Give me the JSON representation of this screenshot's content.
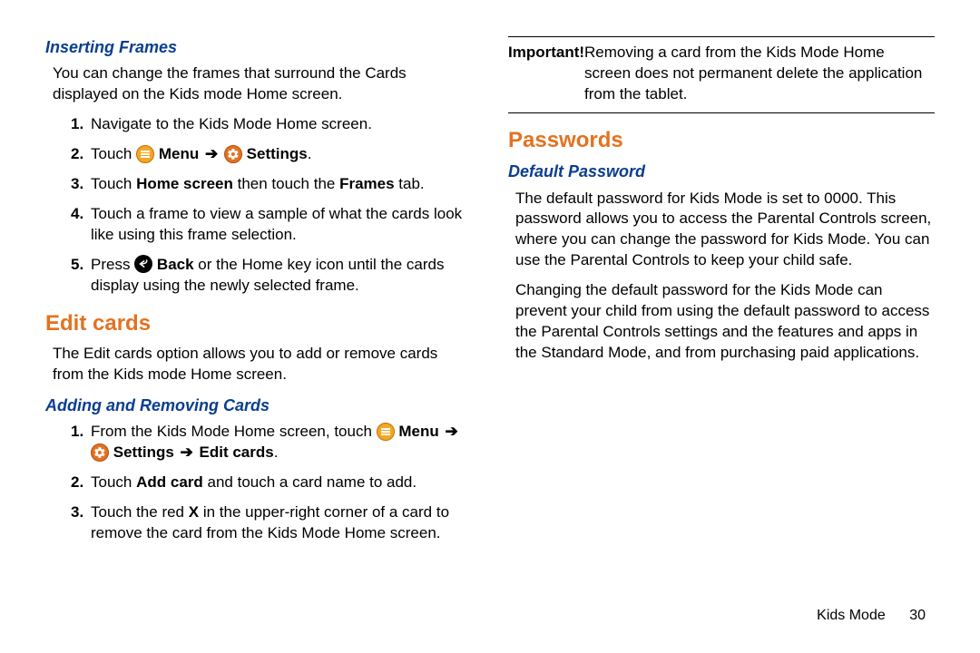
{
  "left": {
    "inserting_frames": {
      "title": "Inserting Frames",
      "intro": "You can change the frames that surround the Cards displayed on the Kids mode Home screen.",
      "steps": {
        "s1": "Navigate to the Kids Mode Home screen.",
        "s2a": "Touch ",
        "s2_menu": " Menu ",
        "s2_arrow": "➔",
        "s2_settings": " Settings",
        "s2_end": ".",
        "s3a": "Touch ",
        "s3_home": "Home screen",
        "s3b": " then touch the ",
        "s3_frames": "Frames",
        "s3c": " tab.",
        "s4": "Touch a frame to view a sample of what the cards look like using this frame selection.",
        "s5a": "Press ",
        "s5_back": " Back",
        "s5b": " or the Home key icon until the cards display using the newly selected frame."
      }
    },
    "edit_cards": {
      "title": "Edit cards",
      "intro": "The Edit cards option allows you to add or remove cards from the Kids mode Home screen."
    },
    "adding_removing": {
      "title": "Adding and Removing Cards",
      "steps": {
        "s1a": "From the Kids Mode Home screen, touch ",
        "s1_menu": " Menu ",
        "s1_arrow": "➔",
        "s1_settings": " Settings ",
        "s1_arrow2": "➔",
        "s1_edit": " Edit cards",
        "s1_end": ".",
        "s2a": "Touch ",
        "s2_add": "Add card",
        "s2b": " and touch a card name to add.",
        "s3a": "Touch the red ",
        "s3_x": "X",
        "s3b": " in the upper-right corner of a card to remove the card from the Kids Mode Home screen."
      }
    }
  },
  "right": {
    "important": {
      "label": "Important!",
      "text": " Removing a card from the Kids Mode Home screen does not permanent delete the application from the tablet."
    },
    "passwords": {
      "title": "Passwords"
    },
    "default_pw": {
      "title": "Default Password",
      "p1": "The default password for Kids Mode is set to 0000. This password allows you to access the Parental Controls screen, where you can change the password for Kids Mode. You can use the Parental Controls to keep your child safe.",
      "p2": "Changing the default password for the Kids Mode can prevent your child from using the default password to access the Parental Controls settings and the features and apps in the Standard Mode, and from purchasing paid applications."
    }
  },
  "footer": {
    "section": "Kids Mode",
    "page": "30"
  }
}
